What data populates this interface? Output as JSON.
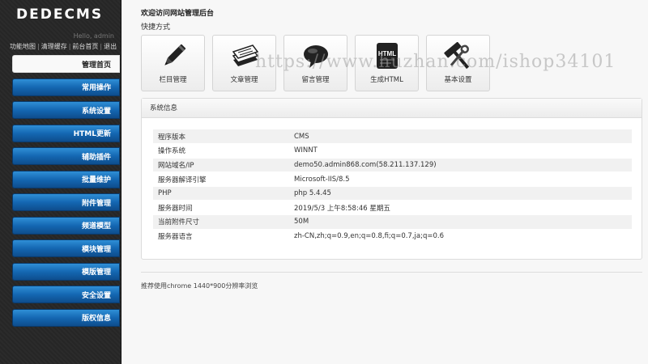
{
  "sidebar": {
    "logo": "DEDECMS",
    "hello": "Hello, admin",
    "links": [
      "功能地图",
      "清理缓存",
      "前台首页",
      "退出"
    ],
    "items": [
      {
        "label": "管理首页",
        "active": true
      },
      {
        "label": "常用操作",
        "active": false
      },
      {
        "label": "系统设置",
        "active": false
      },
      {
        "label": "HTML更新",
        "active": false
      },
      {
        "label": "辅助插件",
        "active": false
      },
      {
        "label": "批量维护",
        "active": false
      },
      {
        "label": "附件管理",
        "active": false
      },
      {
        "label": "频道模型",
        "active": false
      },
      {
        "label": "模块管理",
        "active": false
      },
      {
        "label": "模版管理",
        "active": false
      },
      {
        "label": "安全设置",
        "active": false
      },
      {
        "label": "版权信息",
        "active": false
      }
    ]
  },
  "main": {
    "welcome": "欢迎访问网站管理后台",
    "shortcut_title": "快捷方式",
    "shortcuts": [
      {
        "label": "栏目管理",
        "icon": "pencil-icon"
      },
      {
        "label": "文章管理",
        "icon": "documents-icon"
      },
      {
        "label": "留言管理",
        "icon": "speech-bubble-icon"
      },
      {
        "label": "生成HTML",
        "icon": "html-file-icon",
        "badge": "HTML"
      },
      {
        "label": "基本设置",
        "icon": "tools-icon"
      }
    ],
    "watermark": "https://www.huzhan.com/ishop34101",
    "panel_title": "系统信息",
    "info_rows": [
      {
        "key": "程序版本",
        "value": "CMS"
      },
      {
        "key": "操作系统",
        "value": "WINNT"
      },
      {
        "key": "网站域名/IP",
        "value": "demo50.admin868.com(58.211.137.129)"
      },
      {
        "key": "服务器解译引擎",
        "value": "Microsoft-IIS/8.5"
      },
      {
        "key": "PHP",
        "value": "php 5.4.45"
      },
      {
        "key": "服务器时间",
        "value": "2019/5/3 上午8:58:46 星期五"
      },
      {
        "key": "当前附件尺寸",
        "value": "50M"
      },
      {
        "key": "服务器语言",
        "value": "zh-CN,zh;q=0.9,en;q=0.8,fi;q=0.7,ja;q=0.6"
      }
    ],
    "footer": "推荐使用chrome 1440*900分辨率浏览"
  },
  "colors": {
    "sidebar_bg": "#262626",
    "nav_blue": "#1467b2",
    "page_bg": "#f7f7f7"
  }
}
